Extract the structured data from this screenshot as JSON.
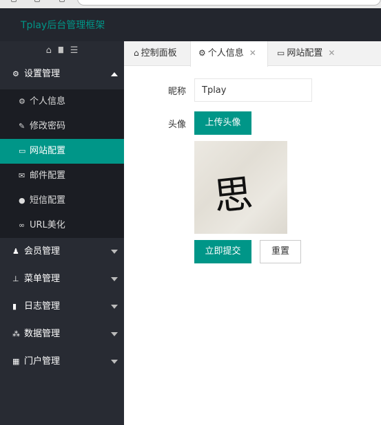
{
  "header": {
    "title": "Tplay后台管理框架"
  },
  "sidebar": {
    "tools": [
      {
        "icon": "home-icon",
        "glyph": "⌂"
      },
      {
        "icon": "trash-icon",
        "glyph": "▇"
      },
      {
        "icon": "menu-icon",
        "glyph": "☰"
      }
    ],
    "sections": [
      {
        "label": "设置管理",
        "icon": "gears-icon",
        "glyph": "⚙",
        "expanded": true,
        "items": [
          {
            "label": "个人信息",
            "icon": "gear-icon",
            "glyph": "⚙",
            "active": false
          },
          {
            "label": "修改密码",
            "icon": "edit-icon",
            "glyph": "✎",
            "active": false
          },
          {
            "label": "网站配置",
            "icon": "desktop-icon",
            "glyph": "▭",
            "active": true
          },
          {
            "label": "邮件配置",
            "icon": "envelope-icon",
            "glyph": "✉",
            "active": false
          },
          {
            "label": "短信配置",
            "icon": "comment-icon",
            "glyph": "●",
            "active": false
          },
          {
            "label": "URL美化",
            "icon": "link-icon",
            "glyph": "∞",
            "active": false
          }
        ]
      },
      {
        "label": "会员管理",
        "icon": "user-icon",
        "glyph": "♟",
        "expanded": false
      },
      {
        "label": "菜单管理",
        "icon": "sitemap-icon",
        "glyph": "⊥",
        "expanded": false
      },
      {
        "label": "日志管理",
        "icon": "book-icon",
        "glyph": "▮",
        "expanded": false
      },
      {
        "label": "数据管理",
        "icon": "cubes-icon",
        "glyph": "⁂",
        "expanded": false
      },
      {
        "label": "门户管理",
        "icon": "grid-icon",
        "glyph": "▦",
        "expanded": false
      }
    ]
  },
  "tabs": [
    {
      "label": "控制面板",
      "icon": "home-outline-icon",
      "glyph": "⌂",
      "closable": false,
      "active": false
    },
    {
      "label": "个人信息",
      "icon": "gear-icon",
      "glyph": "⚙",
      "closable": true,
      "active": true
    },
    {
      "label": "网站配置",
      "icon": "desktop-icon",
      "glyph": "▭",
      "closable": true,
      "active": false
    }
  ],
  "form": {
    "nickname_label": "昵称",
    "nickname_value": "Tplay",
    "avatar_label": "头像",
    "upload_label": "上传头像",
    "avatar_glyph": "思",
    "submit_label": "立即提交",
    "reset_label": "重置"
  },
  "close_glyph": "✕",
  "colors": {
    "accent": "#009688",
    "header_bg": "#23262e",
    "sidebar_bg": "#282b33",
    "submenu_bg": "#1b1d23"
  }
}
